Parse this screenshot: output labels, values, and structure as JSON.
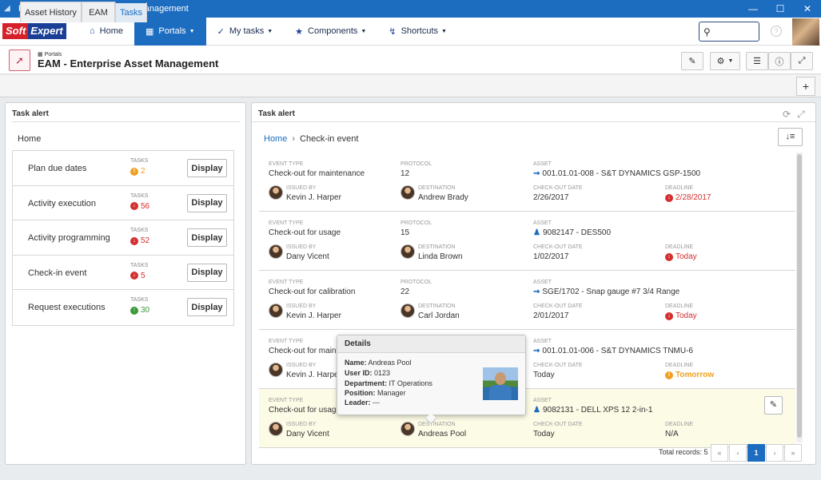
{
  "window": {
    "title": "Portal/EAM - Enterprise Asset Management"
  },
  "nav": {
    "logo_a": "Soft",
    "logo_b": "Expert",
    "items": [
      {
        "label": "Home",
        "icon": "home-icon"
      },
      {
        "label": "Portals",
        "icon": "portals-grid-icon",
        "active": true
      },
      {
        "label": "My tasks",
        "icon": "check-icon"
      },
      {
        "label": "Components",
        "icon": "trophy-icon"
      },
      {
        "label": "Shortcuts",
        "icon": "lightning-icon"
      }
    ],
    "search_placeholder": ""
  },
  "header": {
    "portal_label": "Portals",
    "title": "EAM - Enterprise Asset Management"
  },
  "tabs": [
    {
      "label": "Asset History"
    },
    {
      "label": "EAM"
    },
    {
      "label": "Tasks",
      "active": true
    }
  ],
  "left_panel": {
    "title": "Task alert",
    "home": "Home",
    "tasks_caption": "TASKS",
    "display_label": "Display",
    "tasks": [
      {
        "name": "Plan due dates",
        "count": "2",
        "status": "warning",
        "color": "#f0a020"
      },
      {
        "name": "Activity execution",
        "count": "56",
        "status": "overdue",
        "color": "#d32f2f"
      },
      {
        "name": "Activity programming",
        "count": "52",
        "status": "overdue",
        "color": "#d32f2f"
      },
      {
        "name": "Check-in event",
        "count": "5",
        "status": "overdue",
        "color": "#d32f2f"
      },
      {
        "name": "Request executions",
        "count": "30",
        "status": "ok",
        "color": "#3a9a3a"
      }
    ]
  },
  "right_panel": {
    "title": "Task alert",
    "breadcrumb": {
      "home": "Home",
      "current": "Check-in event"
    },
    "labels": {
      "event_type": "EVENT TYPE",
      "protocol": "PROTOCOL",
      "asset": "ASSET",
      "issued_by": "ISSUED BY",
      "destination": "DESTINATION",
      "checkout_date": "CHECK-OUT DATE",
      "deadline": "DEADLINE"
    },
    "events": [
      {
        "event_type": "Check-out for maintenance",
        "protocol": "12",
        "asset_icon": "tool-icon",
        "asset": "001.01.01-008 - S&T DYNAMICS GSP-1500",
        "issued_by": "Kevin J. Harper",
        "destination": "Andrew Brady",
        "checkout_date": "2/26/2017",
        "deadline": "2/28/2017",
        "deadline_status": "overdue"
      },
      {
        "event_type": "Check-out for usage",
        "protocol": "15",
        "asset_icon": "person-asset-icon",
        "asset": "9082147 - DES500",
        "issued_by": "Dany Vicent",
        "destination": "Linda Brown",
        "checkout_date": "1/02/2017",
        "deadline": "Today",
        "deadline_status": "overdue"
      },
      {
        "event_type": "Check-out for calibration",
        "protocol": "22",
        "asset_icon": "calibration-icon",
        "asset": "SGE/1702 - Snap gauge #7 3/4 Range",
        "issued_by": "Kevin J. Harper",
        "destination": "Carl Jordan",
        "checkout_date": "2/01/2017",
        "deadline": "Today",
        "deadline_status": "overdue"
      },
      {
        "event_type": "Check-out for mainte",
        "protocol": "",
        "asset_icon": "tool-icon",
        "asset": "001.01.01-006 - S&T DYNAMICS TNMU-6",
        "issued_by": "Kevin J. Harpe",
        "destination": "",
        "checkout_date": "Today",
        "deadline": "Tomorrow",
        "deadline_status": "soon"
      },
      {
        "event_type": "Check-out for usage",
        "protocol": "",
        "asset_icon": "person-asset-icon",
        "asset": "9082131 - DELL XPS 12 2-in-1",
        "issued_by": "Dany Vicent",
        "destination": "Andreas Pool",
        "checkout_date": "Today",
        "deadline": "N/A",
        "deadline_status": "none",
        "highlighted": true
      }
    ],
    "pager": {
      "total": "Total records: 5",
      "first": "«",
      "prev": "‹",
      "page": "1",
      "next": "›",
      "last": "»"
    }
  },
  "tooltip": {
    "title": "Details",
    "name_label": "Name:",
    "name": "Andreas Pool",
    "userid_label": "User ID:",
    "userid": "0123",
    "dept_label": "Department:",
    "dept": "IT Operations",
    "position_label": "Position:",
    "position": "Manager",
    "leader_label": "Leader:",
    "leader": "---"
  }
}
